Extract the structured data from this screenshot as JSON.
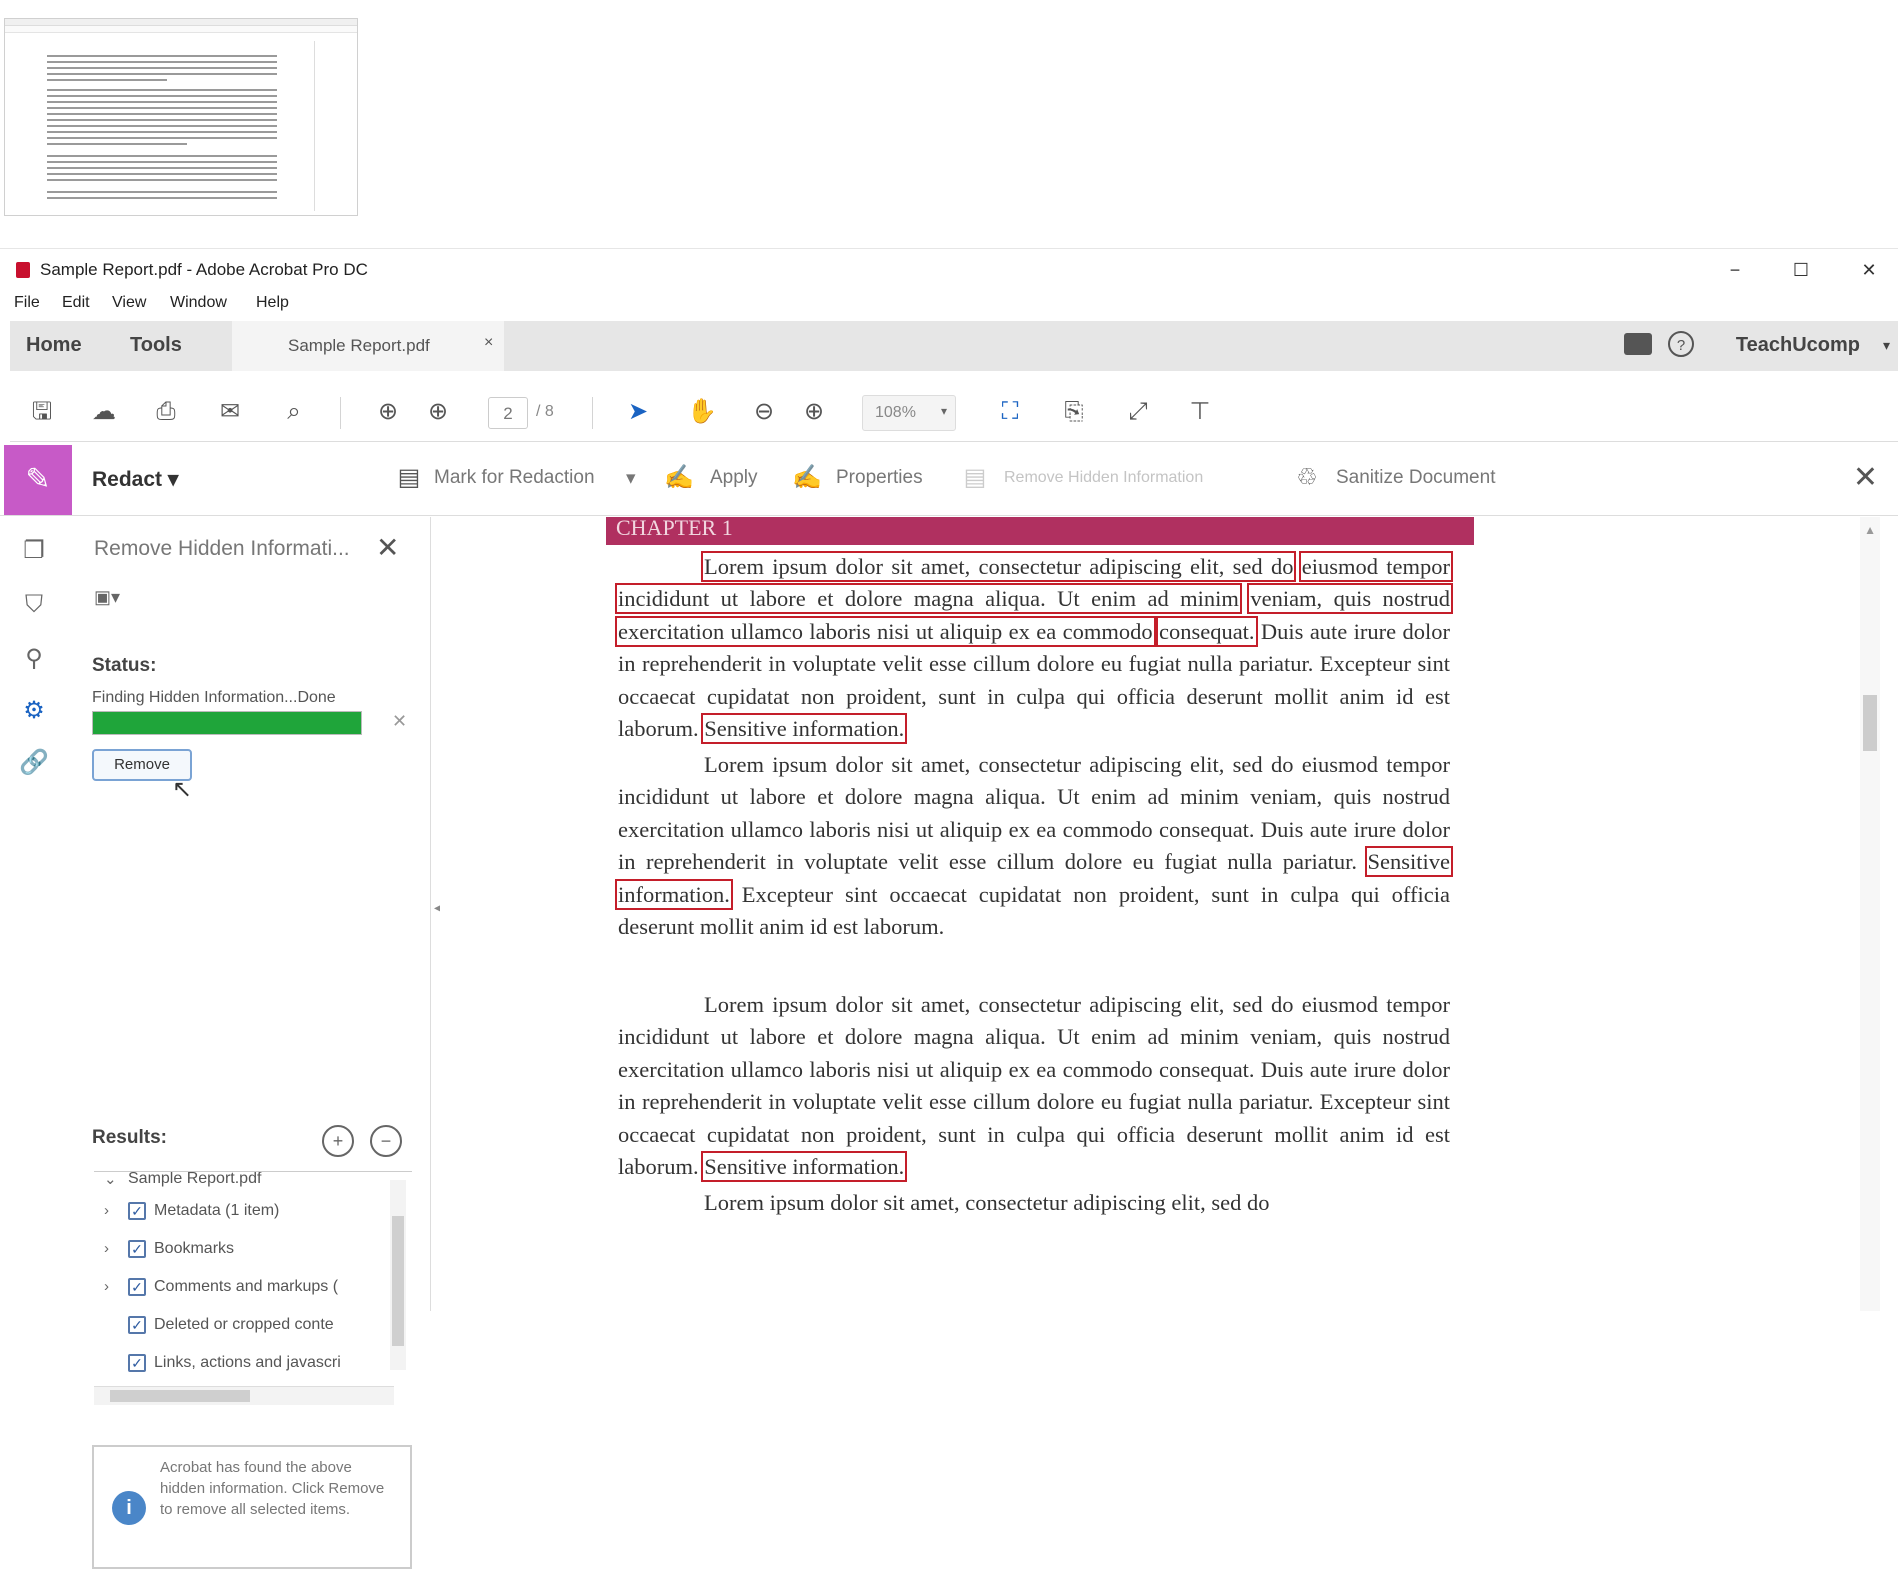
{
  "window": {
    "title": "Sample Report.pdf - Adobe Acrobat Pro DC",
    "minimize": "−",
    "maximize": "☐",
    "close": "✕"
  },
  "menu": [
    "File",
    "Edit",
    "View",
    "Window",
    "Help"
  ],
  "tabs": {
    "home": "Home",
    "tools": "Tools",
    "document": "Sample Report.pdf",
    "document_close": "×",
    "user": "TeachUcomp",
    "user_caret": "▾",
    "help": "?"
  },
  "toolbar": {
    "page_current": "2",
    "page_total": "/ 8",
    "zoom": "108%",
    "zoom_caret": "▾",
    "icons": {
      "save": "save-icon",
      "upload": "cloud-upload-icon",
      "print": "print-icon",
      "email": "email-icon",
      "search": "search-icon",
      "page_up": "page-up-icon",
      "page_down": "page-down-icon",
      "select": "pointer-icon",
      "hand": "hand-icon",
      "zoom_out": "zoom-out-icon",
      "zoom_in": "zoom-in-icon"
    }
  },
  "redact_toolbar": {
    "label": "Redact ▾",
    "mark": "Mark for Redaction",
    "mark_caret": "▾",
    "apply": "Apply",
    "properties": "Properties",
    "remove_hidden": "Remove Hidden Information",
    "sanitize": "Sanitize Document",
    "close": "✕"
  },
  "panel": {
    "title": "Remove Hidden Informati...",
    "close": "✕",
    "status_label": "Status:",
    "status_text": "Finding Hidden Information...Done",
    "progress": 1.0,
    "progress_cancel": "✕",
    "remove_button": "Remove",
    "results_label": "Results:",
    "expand_all": "+",
    "collapse_all": "−",
    "tree": {
      "root": "Sample Report.pdf",
      "items": [
        {
          "label": "Metadata (1 item)",
          "expandable": true,
          "checked": true
        },
        {
          "label": "Bookmarks",
          "expandable": true,
          "checked": true
        },
        {
          "label": "Comments and markups (",
          "expandable": true,
          "checked": true
        },
        {
          "label": "Deleted or cropped conte",
          "expandable": false,
          "checked": true
        },
        {
          "label": "Links, actions and javascri",
          "expandable": false,
          "checked": true
        }
      ]
    },
    "info": "Acrobat has found the above hidden information. Click Remove to remove all selected items."
  },
  "document": {
    "chapter": "CHAPTER 1",
    "p1": {
      "r1": "Lorem ipsum dolor sit amet, consectetur adipiscing elit, sed do",
      "r2": "eiusmod tempor incididunt ut labore et dolore magna aliqua. Ut enim ad minim",
      "r3": "veniam, quis nostrud exercitation ullamco laboris nisi ut aliquip ex ea commodo",
      "r4": "consequat.",
      "mid": " Duis aute irure dolor in reprehenderit in voluptate velit esse cillum dolore eu fugiat nulla pariatur. Excepteur sint occaecat cupidatat non proident, sunt in culpa qui officia deserunt mollit anim id est laborum. ",
      "r5": "Sensitive information."
    },
    "p2": {
      "pre": "Lorem ipsum dolor sit amet, consectetur adipiscing elit, sed do eiusmod tempor incididunt ut labore et dolore magna aliqua. Ut enim ad minim veniam, quis nostrud exercitation ullamco laboris nisi ut aliquip ex ea commodo consequat. Duis aute irure dolor in reprehenderit in voluptate velit esse cillum dolore eu fugiat nulla pariatur. ",
      "r1": "Sensitive information.",
      "post": " Excepteur sint occaecat cupidatat non proident, sunt in culpa qui officia deserunt mollit anim id est laborum."
    },
    "p3": {
      "pre": "Lorem ipsum dolor sit amet, consectetur adipiscing elit, sed do eiusmod tempor incididunt ut labore et dolore magna aliqua. Ut enim ad minim veniam, quis nostrud exercitation ullamco laboris nisi ut aliquip ex ea commodo consequat. Duis aute irure dolor in reprehenderit in voluptate velit esse cillum dolore eu fugiat nulla pariatur. Excepteur sint occaecat cupidatat non proident, sunt in culpa qui officia deserunt mollit anim id est laborum. ",
      "r1": "Sensitive information."
    },
    "p4": "Lorem ipsum dolor sit amet, consectetur adipiscing elit, sed do"
  }
}
